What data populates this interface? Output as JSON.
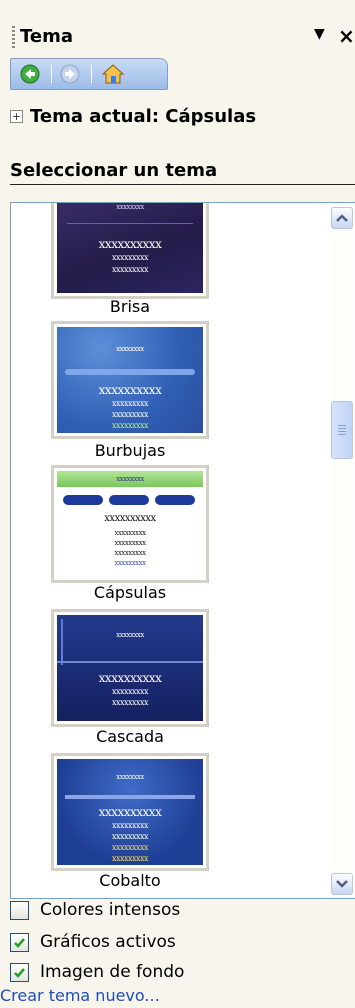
{
  "header": {
    "title": "Tema",
    "close_glyph": "×"
  },
  "nav": {
    "back_icon": "back-arrow-icon",
    "forward_icon": "forward-arrow-icon",
    "home_icon": "home-icon"
  },
  "current_theme": {
    "label": "Tema actual: Cápsulas",
    "expand_glyph": "+"
  },
  "section": {
    "title": "Seleccionar un tema"
  },
  "gallery": {
    "placeholder_short": "xxxxxxxx",
    "placeholder_long": "xxxxxxxxxx",
    "placeholder_mid": "xxxxxxxxx",
    "themes": [
      {
        "name": "Brisa"
      },
      {
        "name": "Burbujas"
      },
      {
        "name": "Cápsulas"
      },
      {
        "name": "Cascada"
      },
      {
        "name": "Cobalto"
      }
    ]
  },
  "options": [
    {
      "label": "Colores intensos",
      "checked": false
    },
    {
      "label": "Gráficos activos",
      "checked": true
    },
    {
      "label": "Imagen de fondo",
      "checked": true
    }
  ],
  "link": {
    "label": "Crear tema nuevo..."
  },
  "colors": {
    "pane_bg": "#f7f5ec",
    "link": "#1f4fb5",
    "check": "#21a121"
  }
}
